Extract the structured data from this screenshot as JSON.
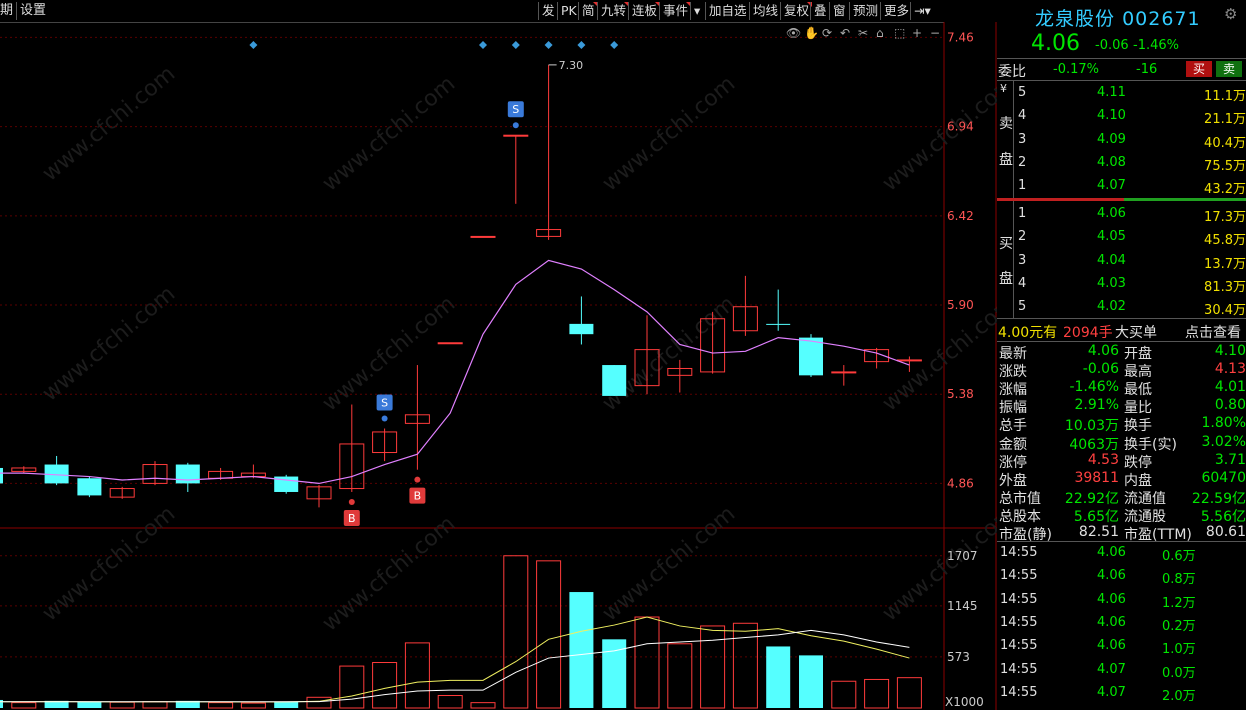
{
  "toolbar": {
    "left": [
      "期",
      "设置"
    ],
    "buttons": [
      "发",
      "PK",
      "简",
      "九转",
      "连板",
      "事件",
      "加自选",
      "均线",
      "复权",
      "叠",
      "窗",
      "预测",
      "更多"
    ]
  },
  "chart": {
    "price_ticks": [
      "7.46",
      "6.94",
      "6.42",
      "5.90",
      "5.38",
      "4.86"
    ],
    "vol_ticks": [
      "1707",
      "1145",
      "573"
    ],
    "vol_unit": "X1000",
    "high_label": "7.30",
    "s_label": "S",
    "b_label": "B",
    "watermark": "www.cfchi.com"
  },
  "chart_data": {
    "type": "candlestick",
    "ylim": [
      4.6,
      7.55
    ],
    "candles": [
      {
        "o": 4.86,
        "c": 4.95,
        "h": 4.97,
        "l": 4.84,
        "up": false
      },
      {
        "o": 4.93,
        "c": 4.95,
        "h": 4.96,
        "l": 4.92,
        "up": true
      },
      {
        "o": 4.97,
        "c": 4.86,
        "h": 5.02,
        "l": 4.85,
        "up": false
      },
      {
        "o": 4.89,
        "c": 4.79,
        "h": 4.9,
        "l": 4.78,
        "up": false
      },
      {
        "o": 4.78,
        "c": 4.83,
        "h": 4.84,
        "l": 4.77,
        "up": true
      },
      {
        "o": 4.86,
        "c": 4.97,
        "h": 4.99,
        "l": 4.85,
        "up": true
      },
      {
        "o": 4.97,
        "c": 4.86,
        "h": 4.98,
        "l": 4.81,
        "up": false
      },
      {
        "o": 4.89,
        "c": 4.93,
        "h": 4.95,
        "l": 4.88,
        "up": true
      },
      {
        "o": 4.9,
        "c": 4.92,
        "h": 4.97,
        "l": 4.89,
        "up": true
      },
      {
        "o": 4.9,
        "c": 4.81,
        "h": 4.91,
        "l": 4.8,
        "up": false
      },
      {
        "o": 4.77,
        "c": 4.84,
        "h": 4.85,
        "l": 4.72,
        "up": true
      },
      {
        "o": 4.83,
        "c": 5.09,
        "h": 5.32,
        "l": 4.81,
        "up": true
      },
      {
        "o": 5.04,
        "c": 5.16,
        "h": 5.18,
        "l": 4.99,
        "up": true
      },
      {
        "o": 5.21,
        "c": 5.26,
        "h": 5.55,
        "l": 4.94,
        "up": true
      },
      {
        "o": 5.68,
        "c": 5.68,
        "h": 5.68,
        "l": 5.68,
        "up": true
      },
      {
        "o": 6.3,
        "c": 6.3,
        "h": 6.3,
        "l": 6.3,
        "up": true
      },
      {
        "o": 6.89,
        "c": 6.89,
        "h": 6.89,
        "l": 6.49,
        "up": true
      },
      {
        "o": 6.3,
        "c": 6.34,
        "h": 7.3,
        "l": 6.28,
        "up": true
      },
      {
        "o": 5.79,
        "c": 5.73,
        "h": 5.95,
        "l": 5.67,
        "up": false
      },
      {
        "o": 5.55,
        "c": 5.37,
        "h": 5.55,
        "l": 5.37,
        "up": false
      },
      {
        "o": 5.43,
        "c": 5.64,
        "h": 5.84,
        "l": 5.38,
        "up": true
      },
      {
        "o": 5.49,
        "c": 5.53,
        "h": 5.58,
        "l": 5.39,
        "up": true
      },
      {
        "o": 5.51,
        "c": 5.82,
        "h": 5.86,
        "l": 5.5,
        "up": true
      },
      {
        "o": 5.75,
        "c": 5.89,
        "h": 6.07,
        "l": 5.72,
        "up": true
      },
      {
        "o": 5.79,
        "c": 5.79,
        "h": 5.99,
        "l": 5.75,
        "up": false
      },
      {
        "o": 5.71,
        "c": 5.49,
        "h": 5.73,
        "l": 5.48,
        "up": false
      },
      {
        "o": 5.51,
        "c": 5.51,
        "h": 5.55,
        "l": 5.43,
        "up": true
      },
      {
        "o": 5.57,
        "c": 5.64,
        "h": 5.65,
        "l": 5.53,
        "up": true
      },
      {
        "o": 5.58,
        "c": 5.58,
        "h": 5.6,
        "l": 5.51,
        "up": true
      }
    ],
    "ma": [
      4.92,
      4.92,
      4.91,
      4.9,
      4.88,
      4.89,
      4.88,
      4.89,
      4.9,
      4.88,
      4.86,
      4.9,
      4.97,
      5.03,
      5.27,
      5.73,
      6.02,
      6.16,
      6.11,
      5.99,
      5.86,
      5.67,
      5.62,
      5.63,
      5.71,
      5.69,
      5.66,
      5.62,
      5.55
    ],
    "vol_ylim": [
      0,
      1850
    ],
    "volumes": [
      {
        "v": 90,
        "up": false
      },
      {
        "v": 60,
        "up": true
      },
      {
        "v": 80,
        "up": false
      },
      {
        "v": 70,
        "up": false
      },
      {
        "v": 65,
        "up": true
      },
      {
        "v": 70,
        "up": true
      },
      {
        "v": 80,
        "up": false
      },
      {
        "v": 60,
        "up": true
      },
      {
        "v": 55,
        "up": true
      },
      {
        "v": 70,
        "up": false
      },
      {
        "v": 120,
        "up": true
      },
      {
        "v": 470,
        "up": true
      },
      {
        "v": 510,
        "up": true
      },
      {
        "v": 730,
        "up": true
      },
      {
        "v": 140,
        "up": true
      },
      {
        "v": 60,
        "up": true
      },
      {
        "v": 1707,
        "up": true
      },
      {
        "v": 1650,
        "up": true
      },
      {
        "v": 1300,
        "up": false
      },
      {
        "v": 770,
        "up": false
      },
      {
        "v": 1020,
        "up": true
      },
      {
        "v": 720,
        "up": true
      },
      {
        "v": 920,
        "up": true
      },
      {
        "v": 950,
        "up": true
      },
      {
        "v": 690,
        "up": false
      },
      {
        "v": 590,
        "up": false
      },
      {
        "v": 300,
        "up": true
      },
      {
        "v": 320,
        "up": true
      },
      {
        "v": 340,
        "up": true
      }
    ],
    "vol_ma1": [
      70,
      70,
      72,
      70,
      68,
      70,
      70,
      68,
      67,
      68,
      75,
      135,
      220,
      290,
      310,
      310,
      520,
      770,
      860,
      930,
      1020,
      920,
      870,
      860,
      890,
      810,
      750,
      660,
      560
    ],
    "vol_ma2": [
      70,
      70,
      70,
      70,
      70,
      70,
      70,
      70,
      70,
      70,
      72,
      100,
      150,
      190,
      200,
      200,
      400,
      560,
      600,
      640,
      720,
      740,
      760,
      790,
      820,
      870,
      820,
      740,
      680
    ]
  },
  "quote": {
    "name": "龙泉股份",
    "code": "002671",
    "price": "4.06",
    "change": "-0.06",
    "pct": "-1.46%",
    "wb_label": "委比",
    "wb_pct": "-0.17%",
    "wb_diff": "-16",
    "buy_btn": "买",
    "sell_btn": "卖",
    "sell_label_1": "卖",
    "sell_label_2": "盘",
    "buy_label_1": "买",
    "buy_label_2": "盘",
    "yen": "¥",
    "sells": [
      {
        "lvl": "5",
        "p": "4.11",
        "v": "11.1万"
      },
      {
        "lvl": "4",
        "p": "4.10",
        "v": "21.1万"
      },
      {
        "lvl": "3",
        "p": "4.09",
        "v": "40.4万"
      },
      {
        "lvl": "2",
        "p": "4.08",
        "v": "75.5万"
      },
      {
        "lvl": "1",
        "p": "4.07",
        "v": "43.2万"
      }
    ],
    "buys": [
      {
        "lvl": "1",
        "p": "4.06",
        "v": "17.3万"
      },
      {
        "lvl": "2",
        "p": "4.05",
        "v": "45.8万"
      },
      {
        "lvl": "3",
        "p": "4.04",
        "v": "13.7万"
      },
      {
        "lvl": "4",
        "p": "4.03",
        "v": "81.3万"
      },
      {
        "lvl": "5",
        "p": "4.02",
        "v": "30.4万"
      }
    ],
    "big_price": "4.00元有",
    "big_hands": "2094手",
    "big_label": "大买单",
    "big_link": "点击查看",
    "stats": [
      {
        "k1": "最新",
        "v1": "4.06",
        "c1": "g",
        "k2": "开盘",
        "v2": "4.10",
        "c2": "g"
      },
      {
        "k1": "涨跌",
        "v1": "-0.06",
        "c1": "g",
        "k2": "最高",
        "v2": "4.13",
        "c2": "r"
      },
      {
        "k1": "涨幅",
        "v1": "-1.46%",
        "c1": "g",
        "k2": "最低",
        "v2": "4.01",
        "c2": "g"
      },
      {
        "k1": "振幅",
        "v1": "2.91%",
        "c1": "g",
        "k2": "量比",
        "v2": "0.80",
        "c2": "g"
      },
      {
        "k1": "总手",
        "v1": "10.03万",
        "c1": "g",
        "k2": "换手",
        "v2": "1.80%",
        "c2": "g"
      },
      {
        "k1": "金额",
        "v1": "4063万",
        "c1": "g",
        "k2": "换手(实)",
        "v2": "3.02%",
        "c2": "g"
      },
      {
        "k1": "涨停",
        "v1": "4.53",
        "c1": "r",
        "k2": "跌停",
        "v2": "3.71",
        "c2": "g"
      },
      {
        "k1": "外盘",
        "v1": "39811",
        "c1": "r",
        "k2": "内盘",
        "v2": "60470",
        "c2": "g"
      },
      {
        "k1": "总市值",
        "v1": "22.92亿",
        "c1": "g",
        "k2": "流通值",
        "v2": "22.59亿",
        "c2": "g"
      },
      {
        "k1": "总股本",
        "v1": "5.65亿",
        "c1": "g",
        "k2": "流通股",
        "v2": "5.56亿",
        "c2": "g"
      },
      {
        "k1": "市盈(静)",
        "v1": "82.51",
        "c1": "w",
        "k2": "市盈(TTM)",
        "v2": "80.61",
        "c2": "w"
      }
    ],
    "ticks": [
      {
        "t": "14:55",
        "p": "4.06",
        "v": "0.6万"
      },
      {
        "t": "14:55",
        "p": "4.06",
        "v": "0.8万"
      },
      {
        "t": "14:55",
        "p": "4.06",
        "v": "1.2万"
      },
      {
        "t": "14:55",
        "p": "4.06",
        "v": "0.2万"
      },
      {
        "t": "14:55",
        "p": "4.06",
        "v": "1.0万"
      },
      {
        "t": "14:55",
        "p": "4.07",
        "v": "0.0万"
      },
      {
        "t": "14:55",
        "p": "4.07",
        "v": "2.0万"
      }
    ]
  }
}
